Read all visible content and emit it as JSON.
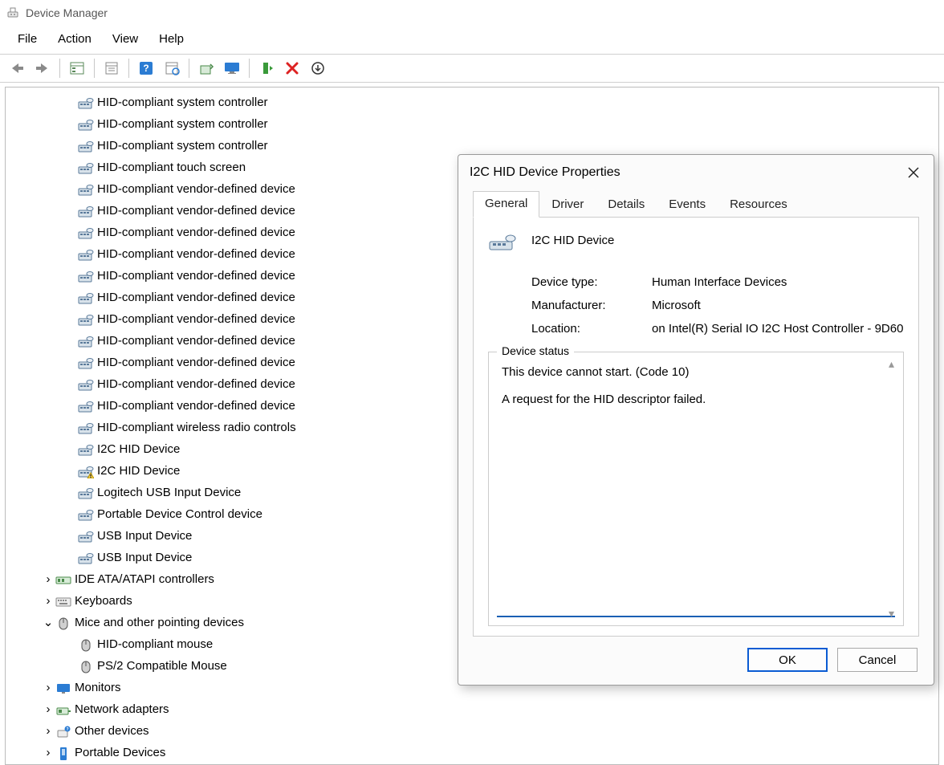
{
  "window": {
    "title": "Device Manager"
  },
  "menu": {
    "file": "File",
    "action": "Action",
    "view": "View",
    "help": "Help"
  },
  "tree": {
    "hid_items": [
      "HID-compliant system controller",
      "HID-compliant system controller",
      "HID-compliant system controller",
      "HID-compliant touch screen",
      "HID-compliant vendor-defined device",
      "HID-compliant vendor-defined device",
      "HID-compliant vendor-defined device",
      "HID-compliant vendor-defined device",
      "HID-compliant vendor-defined device",
      "HID-compliant vendor-defined device",
      "HID-compliant vendor-defined device",
      "HID-compliant vendor-defined device",
      "HID-compliant vendor-defined device",
      "HID-compliant vendor-defined device",
      "HID-compliant vendor-defined device",
      "HID-compliant wireless radio controls",
      "I2C HID Device",
      "I2C HID Device",
      "Logitech USB Input Device",
      "Portable Device Control device",
      "USB Input Device",
      "USB Input Device"
    ],
    "hid_warning_index": 17,
    "cat_ide": "IDE ATA/ATAPI controllers",
    "cat_keyboards": "Keyboards",
    "cat_mice": "Mice and other pointing devices",
    "mice_items": [
      "HID-compliant mouse",
      "PS/2 Compatible Mouse"
    ],
    "cat_monitors": "Monitors",
    "cat_network": "Network adapters",
    "cat_other": "Other devices",
    "cat_portable": "Portable Devices"
  },
  "dialog": {
    "title": "I2C HID Device Properties",
    "tabs": {
      "general": "General",
      "driver": "Driver",
      "details": "Details",
      "events": "Events",
      "resources": "Resources"
    },
    "device_name": "I2C HID Device",
    "labels": {
      "type": "Device type:",
      "manufacturer": "Manufacturer:",
      "location": "Location:",
      "status": "Device status"
    },
    "values": {
      "type": "Human Interface Devices",
      "manufacturer": "Microsoft",
      "location": "on Intel(R) Serial IO I2C Host Controller - 9D60"
    },
    "status_text": "This device cannot start. (Code 10)\n\nA request for the HID descriptor failed.",
    "buttons": {
      "ok": "OK",
      "cancel": "Cancel"
    }
  }
}
